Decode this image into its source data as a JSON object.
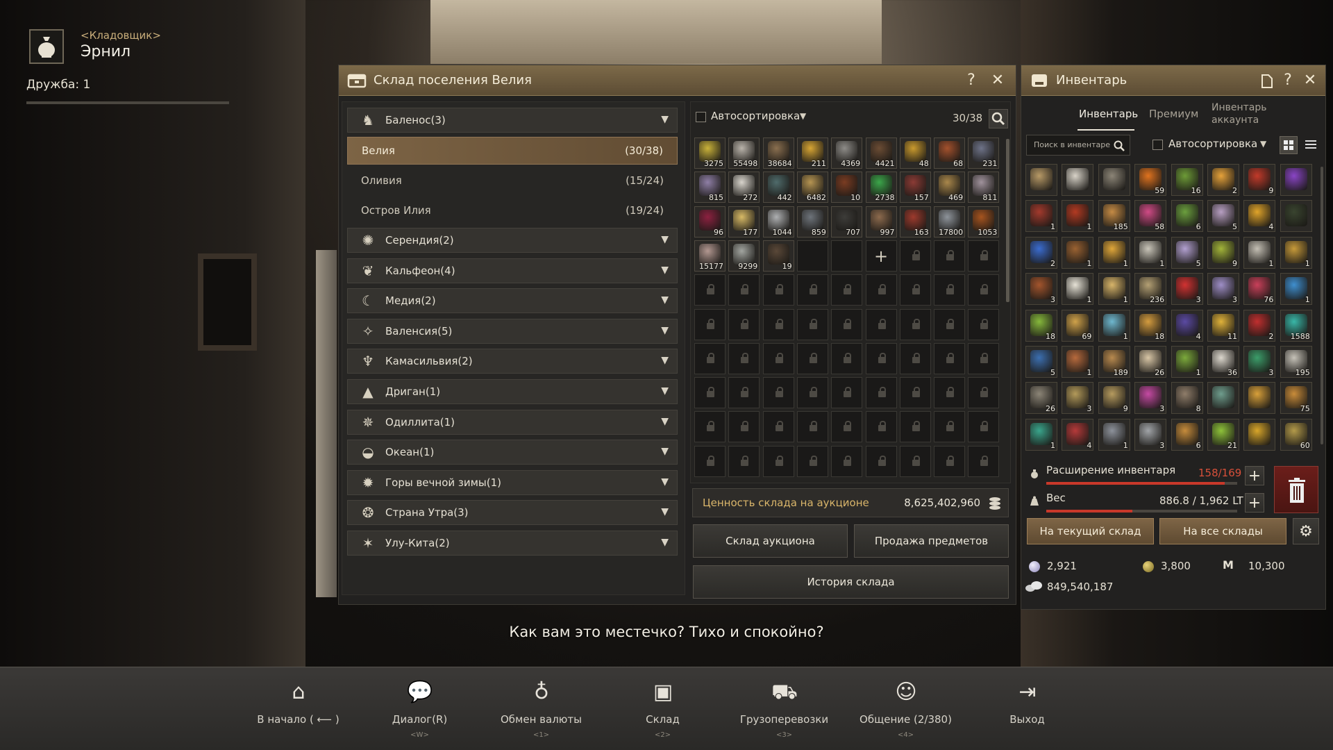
{
  "npc": {
    "role": "<Кладовщик>",
    "name": "Эрнил",
    "friendship": "Дружба: 1",
    "friendship_progress": 0
  },
  "subtitle": "Как вам это местечко? Тихо и спокойно?",
  "storage": {
    "title": "Склад поселения Велия",
    "help": "?",
    "close": "✕",
    "regions": [
      {
        "label": "Баленос(3)",
        "icon": "horse-icon"
      },
      {
        "label": "Серендия(2)",
        "icon": "serendia-icon"
      },
      {
        "label": "Кальфеон(4)",
        "icon": "calpheon-icon"
      },
      {
        "label": "Медия(2)",
        "icon": "mediah-icon"
      },
      {
        "label": "Валенсия(5)",
        "icon": "valencia-icon"
      },
      {
        "label": "Камасильвия(2)",
        "icon": "kamasylvia-icon"
      },
      {
        "label": "Дриган(1)",
        "icon": "drieghan-icon"
      },
      {
        "label": "Одиллита(1)",
        "icon": "odyllita-icon"
      },
      {
        "label": "Океан(1)",
        "icon": "ocean-icon"
      },
      {
        "label": "Горы вечной зимы(1)",
        "icon": "mountain-icon"
      },
      {
        "label": "Страна Утра(3)",
        "icon": "morning-icon"
      },
      {
        "label": "Улу-Кита(2)",
        "icon": "ulukita-icon"
      }
    ],
    "towns": [
      {
        "name": "Велия",
        "count": "(30/38)",
        "selected": true
      },
      {
        "name": "Оливия",
        "count": "(15/24)"
      },
      {
        "name": "Остров Илия",
        "count": "(19/24)"
      }
    ],
    "autosort": "Автосортировка",
    "slots": "30/38",
    "items": [
      {
        "count": "3275",
        "color": "#c9b23a"
      },
      {
        "count": "55498",
        "color": "#b9b3aa"
      },
      {
        "count": "38684",
        "color": "#8a6f4f"
      },
      {
        "count": "211",
        "color": "#d7a534"
      },
      {
        "count": "4369",
        "color": "#8e8c88"
      },
      {
        "count": "4421",
        "color": "#6b4c34"
      },
      {
        "count": "48",
        "color": "#c99a2e"
      },
      {
        "count": "68",
        "color": "#a3512d"
      },
      {
        "count": "231",
        "color": "#6e7388"
      },
      {
        "count": "815",
        "color": "#8f7fa6"
      },
      {
        "count": "272",
        "color": "#d8d4cc"
      },
      {
        "count": "442",
        "color": "#4f6b6b"
      },
      {
        "count": "6482",
        "color": "#b59452"
      },
      {
        "count": "10",
        "color": "#7a3c22"
      },
      {
        "count": "2738",
        "color": "#3ca64a"
      },
      {
        "count": "157",
        "color": "#8b3b35"
      },
      {
        "count": "469",
        "color": "#a9874b"
      },
      {
        "count": "811",
        "color": "#a0929c"
      },
      {
        "count": "96",
        "color": "#8c2140"
      },
      {
        "count": "177",
        "color": "#d8ba66"
      },
      {
        "count": "1044",
        "color": "#aeb0b2"
      },
      {
        "count": "859",
        "color": "#6d737a"
      },
      {
        "count": "707",
        "color": "#3d3c39"
      },
      {
        "count": "997",
        "color": "#8c6a4d"
      },
      {
        "count": "163",
        "color": "#9d3a2d"
      },
      {
        "count": "17800",
        "color": "#8e949b"
      },
      {
        "count": "1053",
        "color": "#a6541f"
      },
      {
        "count": "15177",
        "color": "#b39891"
      },
      {
        "count": "9299",
        "color": "#a2a5a0"
      },
      {
        "count": "19",
        "color": "#5a4838"
      }
    ],
    "add_slot": "+",
    "auction_value_label": "Ценность склада на аукционе",
    "auction_value": "8,625,402,960",
    "btn_auction": "Склад аукциона",
    "btn_sell": "Продажа предметов",
    "btn_history": "История склада"
  },
  "inventory": {
    "title": "Инвентарь",
    "tabs": [
      "Инвентарь",
      "Премиум",
      "Инвентарь аккаунта"
    ],
    "search_placeholder": "Поиск в инвентаре",
    "autosort": "Автосортировка",
    "items": [
      {
        "count": "",
        "color": "#b89a67"
      },
      {
        "count": "",
        "color": "#d8d3c8"
      },
      {
        "count": "",
        "color": "#8c8577"
      },
      {
        "count": "59",
        "color": "#e0731f"
      },
      {
        "count": "16",
        "color": "#6d9b37"
      },
      {
        "count": "2",
        "color": "#e6a23a"
      },
      {
        "count": "9",
        "color": "#c23a2a"
      },
      {
        "count": "",
        "color": "#8a45c6"
      },
      {
        "count": "1",
        "color": "#a33a2d"
      },
      {
        "count": "1",
        "color": "#b33a22"
      },
      {
        "count": "185",
        "color": "#c58b45"
      },
      {
        "count": "58",
        "color": "#d04b86"
      },
      {
        "count": "6",
        "color": "#6b9f3e"
      },
      {
        "count": "5",
        "color": "#b79fc2"
      },
      {
        "count": "4",
        "color": "#e0a42a"
      },
      {
        "count": "",
        "color": "#39442f"
      },
      {
        "count": "2",
        "color": "#3b6ccf"
      },
      {
        "count": "1",
        "color": "#9a6232"
      },
      {
        "count": "1",
        "color": "#e0a73a"
      },
      {
        "count": "1",
        "color": "#c9c5b9"
      },
      {
        "count": "5",
        "color": "#b2a0d0"
      },
      {
        "count": "9",
        "color": "#a2b43a"
      },
      {
        "count": "1",
        "color": "#c4bfb4"
      },
      {
        "count": "1",
        "color": "#c79a3a"
      },
      {
        "count": "3",
        "color": "#a3552d"
      },
      {
        "count": "1",
        "color": "#e6e2d6"
      },
      {
        "count": "1",
        "color": "#d8b56a"
      },
      {
        "count": "236",
        "color": "#b4a074"
      },
      {
        "count": "3",
        "color": "#d23232"
      },
      {
        "count": "3",
        "color": "#9e8ec6"
      },
      {
        "count": "76",
        "color": "#c9405a"
      },
      {
        "count": "1",
        "color": "#3f8fcf"
      },
      {
        "count": "18",
        "color": "#86b83c"
      },
      {
        "count": "69",
        "color": "#d0a24a"
      },
      {
        "count": "1",
        "color": "#6fb8cf"
      },
      {
        "count": "18",
        "color": "#d49c3f"
      },
      {
        "count": "4",
        "color": "#5b4aa3"
      },
      {
        "count": "11",
        "color": "#e0b23a"
      },
      {
        "count": "2",
        "color": "#c02f2f"
      },
      {
        "count": "1588",
        "color": "#39b7a8"
      },
      {
        "count": "5",
        "color": "#3c6fb0"
      },
      {
        "count": "1",
        "color": "#b76a3d"
      },
      {
        "count": "189",
        "color": "#b88a4f"
      },
      {
        "count": "26",
        "color": "#d8c6a6"
      },
      {
        "count": "1",
        "color": "#7caa3c"
      },
      {
        "count": "36",
        "color": "#dcd7cd"
      },
      {
        "count": "3",
        "color": "#3c9d6a"
      },
      {
        "count": "195",
        "color": "#c6c2b8"
      },
      {
        "count": "26",
        "color": "#8c8577"
      },
      {
        "count": "3",
        "color": "#b39a5a"
      },
      {
        "count": "9",
        "color": "#b69b5f"
      },
      {
        "count": "3",
        "color": "#c54aa3"
      },
      {
        "count": "8",
        "color": "#8f7d6a"
      },
      {
        "count": "",
        "color": "#6f9d8d"
      },
      {
        "count": "",
        "color": "#d8a03a"
      },
      {
        "count": "75",
        "color": "#c98c3a"
      },
      {
        "count": "1",
        "color": "#3aa58c"
      },
      {
        "count": "4",
        "color": "#b53a3a"
      },
      {
        "count": "1",
        "color": "#8d929b"
      },
      {
        "count": "3",
        "color": "#a1a4a8"
      },
      {
        "count": "6",
        "color": "#c68c3c"
      },
      {
        "count": "21",
        "color": "#8ec23a"
      },
      {
        "count": "",
        "color": "#d8a62a"
      },
      {
        "count": "60",
        "color": "#b39a4a"
      }
    ],
    "expand_label": "Расширение инвентаря",
    "expand_value": "158/169",
    "expand_progress": 0.935,
    "weight_label": "Вес",
    "weight_value": "886.8 / 1,962 LT",
    "weight_progress": 0.452,
    "btn_current": "На текущий склад",
    "btn_all": "На все склады",
    "currency": {
      "pearl": "2,921",
      "coin": "3,800",
      "energy": "10,300",
      "silver": "849,540,187"
    }
  },
  "dock": [
    {
      "label": "В начало ( ⟵ )",
      "key": "",
      "icon": "home-icon",
      "glyph": "⌂"
    },
    {
      "label": "Диалог(R)",
      "key": "<W>",
      "icon": "dialog-icon",
      "glyph": "💬"
    },
    {
      "label": "Обмен валюты",
      "key": "<1>",
      "icon": "currency-exchange-icon",
      "glyph": "♁"
    },
    {
      "label": "Склад",
      "key": "<2>",
      "icon": "storage-icon",
      "glyph": "▣"
    },
    {
      "label": "Грузоперевозки",
      "key": "<3>",
      "icon": "cargo-icon",
      "glyph": "⛟"
    },
    {
      "label": "Общение (2/380)",
      "key": "<4>",
      "icon": "social-icon",
      "glyph": "☺"
    },
    {
      "label": "Выход",
      "key": "",
      "icon": "exit-icon",
      "glyph": "⇥"
    }
  ],
  "colors": {
    "accent": "#7d6a49",
    "title_bar": "#5c4c34",
    "expand_bar": "#c8382a",
    "weight_bar": "#c8382a",
    "value_text": "#d9b56a"
  }
}
